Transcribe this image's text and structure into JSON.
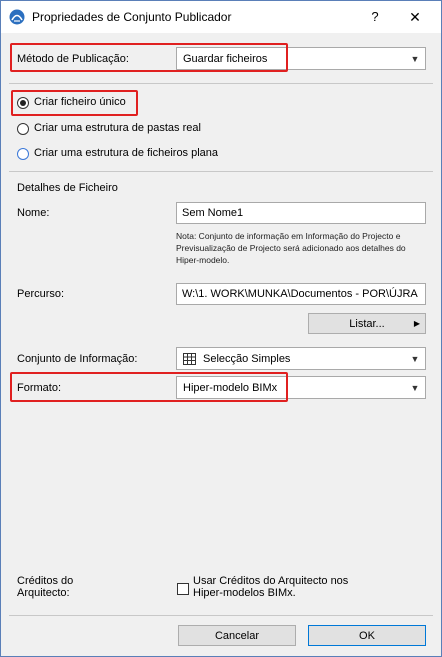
{
  "window": {
    "title": "Propriedades de Conjunto Publicador",
    "help_symbol": "?",
    "close_symbol": "✕"
  },
  "publish_method": {
    "label": "Método de Publicação:",
    "value": "Guardar ficheiros"
  },
  "options": [
    {
      "label": "Criar ficheiro único",
      "selected": true
    },
    {
      "label": "Criar uma estrutura de pastas real",
      "selected": false
    },
    {
      "label": "Criar uma estrutura de ficheiros plana",
      "selected": false
    }
  ],
  "file_details": {
    "heading": "Detalhes de Ficheiro",
    "name_label": "Nome:",
    "name_value": "Sem Nome1",
    "note_line1": "Nota: Conjunto de informação em Informação do Projecto e",
    "note_line2": "Previsualização de Projecto será adicionado aos detalhes do",
    "note_line3": "Hiper-modelo.",
    "path_label": "Percurso:",
    "path_value": "W:\\1. WORK\\MUNKA\\Documentos - POR\\ÚJRA",
    "list_button": "Listar...",
    "info_set_label": "Conjunto de Informação:",
    "info_set_value": "Selecção Simples",
    "format_label": "Formato:",
    "format_value": "Hiper-modelo BIMx"
  },
  "credits": {
    "label_line1": "Créditos do",
    "label_line2": "Arquitecto:",
    "checkbox_line1": "Usar Créditos do Arquitecto nos",
    "checkbox_line2": "Hiper-modelos BIMx.",
    "checked": false
  },
  "buttons": {
    "cancel": "Cancelar",
    "ok": "OK"
  },
  "colors": {
    "highlight": "#e02020",
    "accent": "#0078d7"
  }
}
